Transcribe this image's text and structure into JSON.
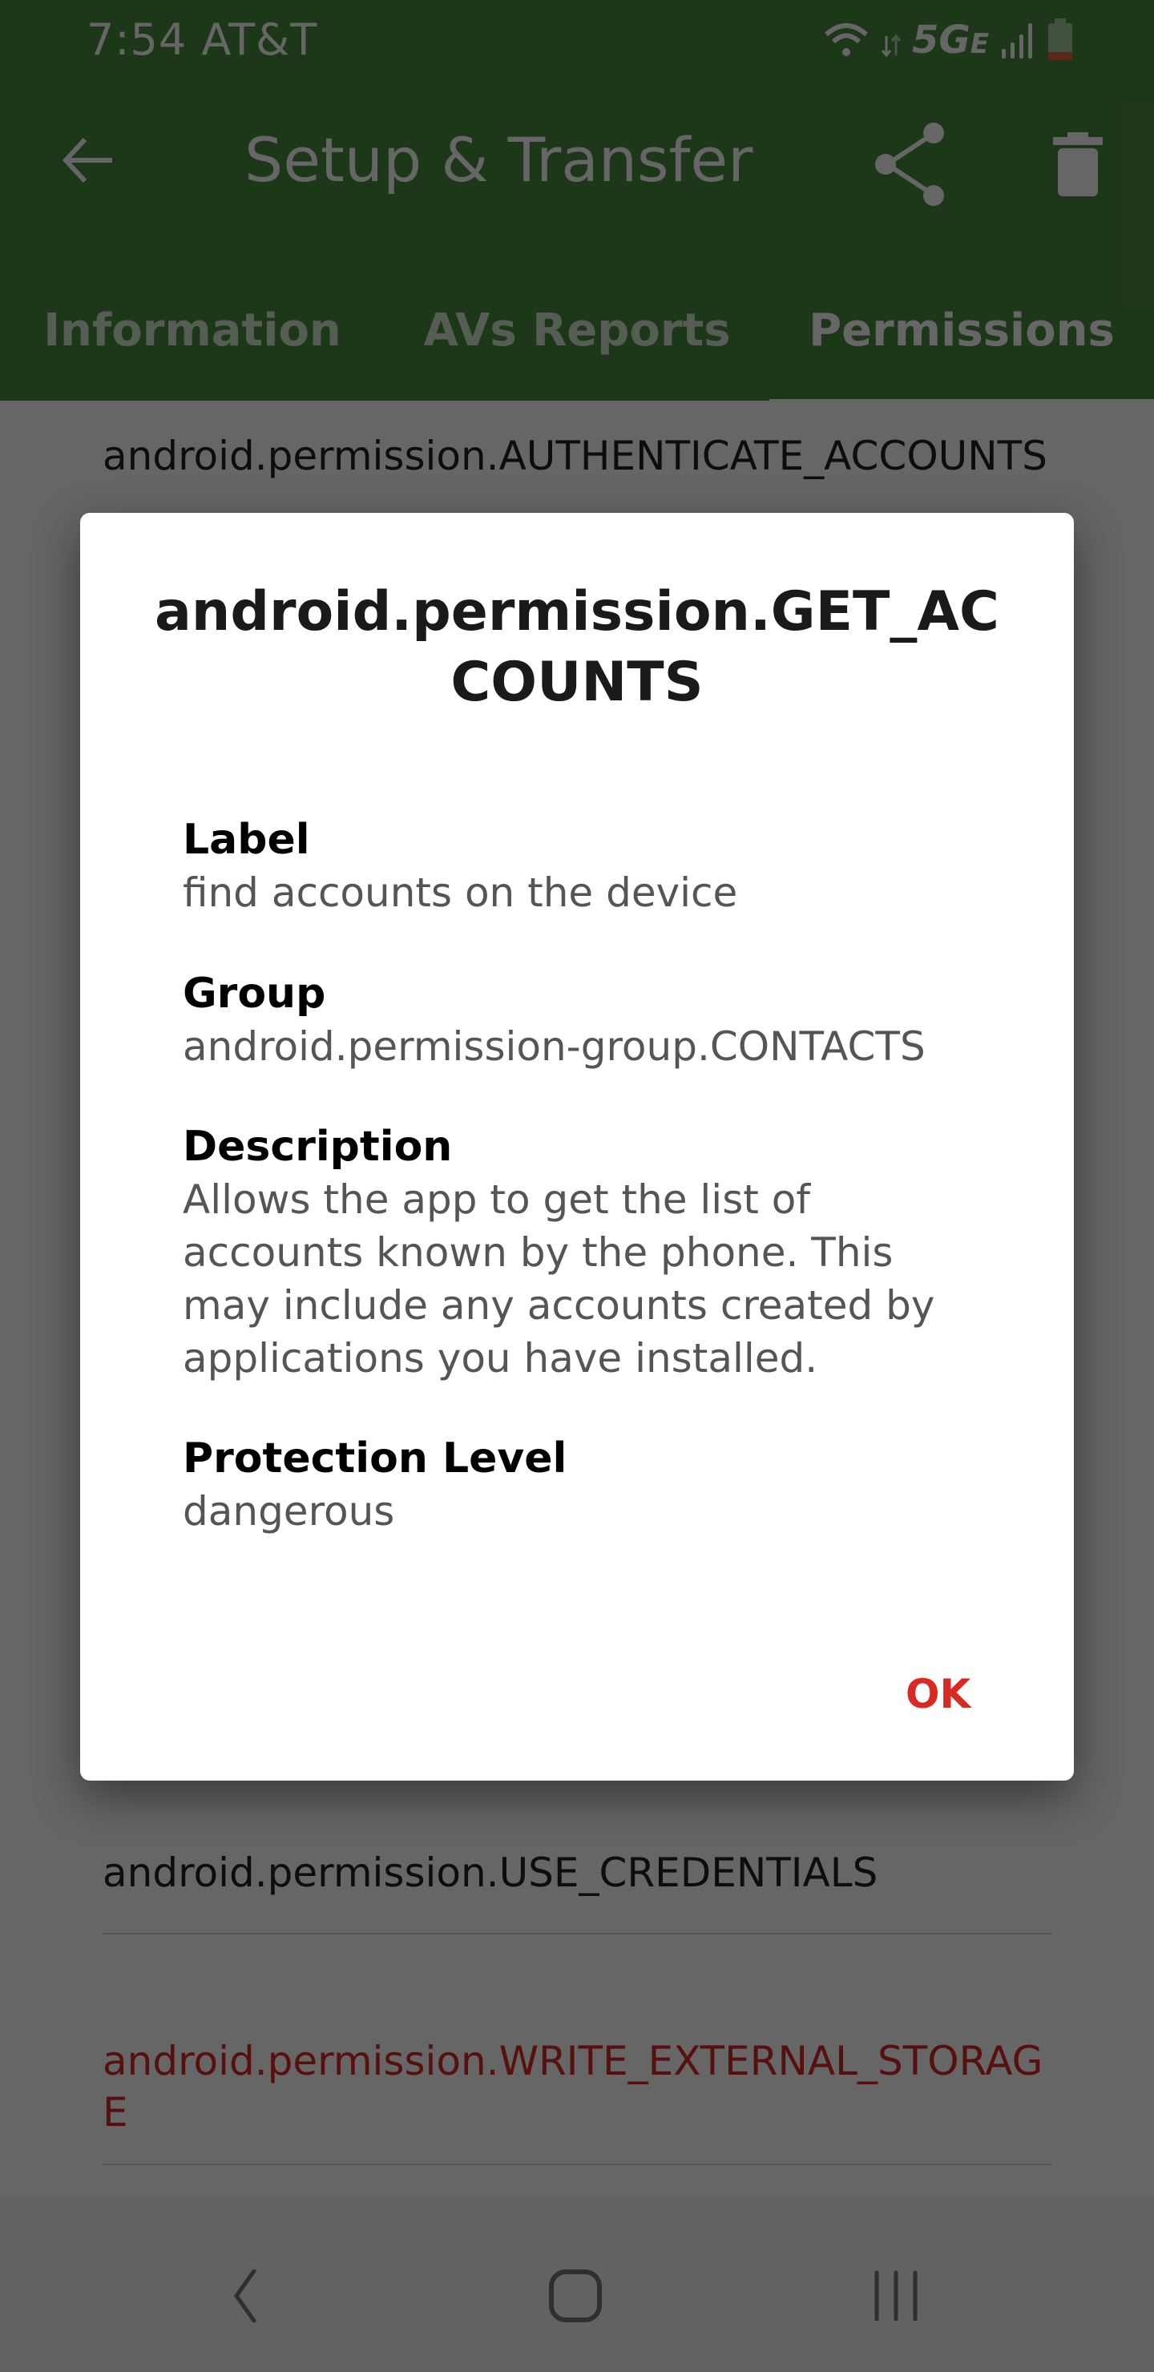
{
  "status_bar": {
    "time_carrier": "7:54 AT&T",
    "network": "5G",
    "network_suffix": "E",
    "icons": [
      "wifi-icon",
      "data-arrows-icon",
      "signal-icon",
      "battery-icon"
    ],
    "battery_color_low": "#e3663a"
  },
  "app_bar": {
    "title": "Setup & Transfer",
    "back_icon": "arrow-left-icon",
    "actions": [
      "share-icon",
      "trash-icon"
    ],
    "background": "#4a8c3d"
  },
  "tabs": [
    {
      "label": "Information",
      "active": false
    },
    {
      "label": "AVs Reports",
      "active": false
    },
    {
      "label": "Permissions",
      "active": true
    }
  ],
  "permission_list": [
    {
      "name": "android.permission.AUTHENTICATE_ACCOUNTS",
      "dangerous": false
    },
    {
      "name": "android.permission.USE_CREDENTIALS",
      "dangerous": false
    },
    {
      "name": "android.permission.WRITE_EXTERNAL_STORAGE",
      "dangerous": true
    }
  ],
  "dialog": {
    "title": "android.permission.GET_ACCOUNTS",
    "fields": [
      {
        "label": "Label",
        "value": "find accounts on the device"
      },
      {
        "label": "Group",
        "value": "android.permission-group.CONTACTS"
      },
      {
        "label": "Description",
        "value": "Allows the app to get the list of accounts known by the phone. This may include any accounts created by applications you have installed."
      },
      {
        "label": "Protection Level",
        "value": "dangerous"
      }
    ],
    "ok_label": "OK",
    "accent": "#d72a23"
  },
  "nav_bar": {
    "buttons": [
      "back-icon",
      "home-icon",
      "recents-icon"
    ]
  }
}
